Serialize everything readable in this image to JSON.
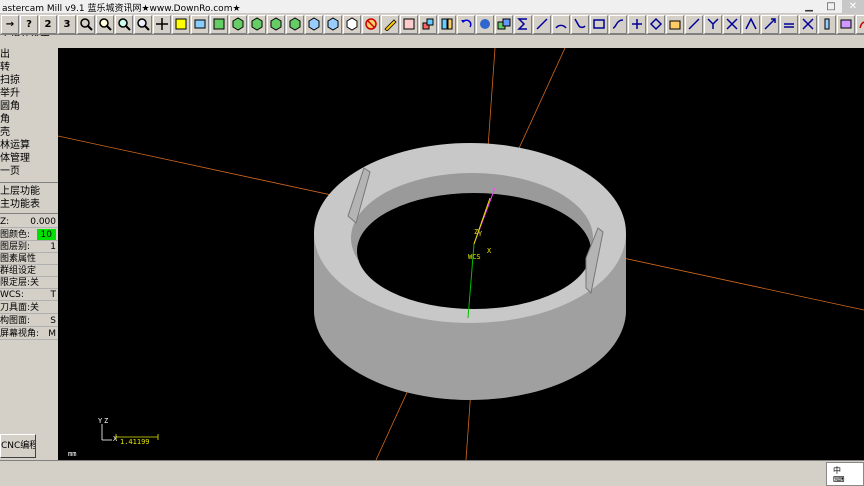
{
  "window": {
    "title": "astercam Mill v9.1 蓝乐城资讯网★www.DownRo.com★",
    "min_glyph": "▁",
    "max_glyph": "□",
    "close_glyph": "✕"
  },
  "toolbar": {
    "buttons": [
      {
        "name": "arrow",
        "label": "→"
      },
      {
        "name": "help",
        "label": "?"
      },
      {
        "name": "two",
        "label": "2"
      },
      {
        "name": "three",
        "label": "3"
      }
    ]
  },
  "prompt": "之相关设定:",
  "left_menu": {
    "items": [
      "出",
      "转",
      "扫掠",
      "举升",
      "圆角",
      "角",
      "壳",
      "林运算",
      "体管理",
      "一页"
    ],
    "nav": [
      "上层功能",
      "主功能表"
    ]
  },
  "params": {
    "z_label": "Z:",
    "z_value": "0.000",
    "color_label": "图颜色:",
    "color_value": "10",
    "level_label": "图层别:",
    "level_value": "1",
    "attr_label": "图素属性",
    "group_label": "群组设定",
    "mask_label": "限定层:关",
    "wcs_label": "WCS:",
    "wcs_value": "T",
    "tplane_label": "刀具面:关",
    "cplane_label": "构图面:",
    "cplane_value": "S",
    "gview_label": "屏幕视角:",
    "gview_value": "M"
  },
  "cnc_button": "CNC编程",
  "viewport": {
    "axis_z": "Z",
    "axis_y": "Y",
    "axis_x": "X",
    "wcs_label": "WCS",
    "corner_y": "Y",
    "corner_z": "Z",
    "corner_x": "X",
    "scale_value": "1.41199",
    "units": "mm"
  },
  "colors": {
    "viewport_bg": "#000000",
    "axis_orange": "#d2691e",
    "axis_yellow": "#e6e600",
    "axis_green": "#00c000",
    "axis_magenta": "#ff40ff",
    "part_light": "#c8c8c8",
    "part_dark": "#7a7a7a",
    "status_green": "#00e000"
  },
  "tray": {
    "line1": "中",
    "line2": "⌨"
  }
}
